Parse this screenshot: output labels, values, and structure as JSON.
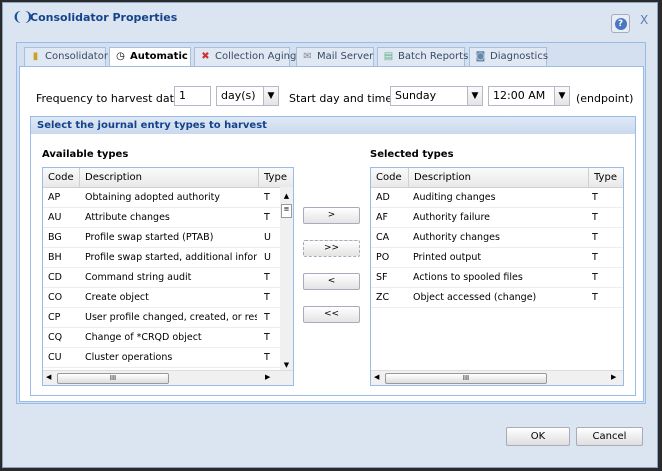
{
  "window": {
    "title": "Consolidator Properties",
    "help": "?",
    "close": "X"
  },
  "tabs": [
    {
      "label": "Consolidator",
      "icon": "consolidator-icon"
    },
    {
      "label": "Automatic",
      "icon": "clock-icon"
    },
    {
      "label": "Collection Aging",
      "icon": "aging-icon"
    },
    {
      "label": "Mail Server",
      "icon": "mail-icon"
    },
    {
      "label": "Batch Reports",
      "icon": "report-icon"
    },
    {
      "label": "Diagnostics",
      "icon": "diagnostics-icon"
    }
  ],
  "form": {
    "freq_label": "Frequency to harvest data:",
    "freq_value": "1",
    "unit": "day(s)",
    "start_label": "Start day and time:",
    "day": "Sunday",
    "time": "12:00 AM",
    "endpoint": "(endpoint)"
  },
  "section": {
    "title": "Select the journal entry types to harvest"
  },
  "available": {
    "title": "Available types",
    "columns": [
      "Code",
      "Description",
      "Type"
    ],
    "rows": [
      [
        "AP",
        "Obtaining adopted authority",
        "T"
      ],
      [
        "AU",
        "Attribute changes",
        "T"
      ],
      [
        "BG",
        "Profile swap started (PTAB)",
        "U"
      ],
      [
        "BH",
        "Profile swap started, additional informa...",
        "U"
      ],
      [
        "CD",
        "Command string audit",
        "T"
      ],
      [
        "CO",
        "Create object",
        "T"
      ],
      [
        "CP",
        "User profile changed, created, or resto...",
        "T"
      ],
      [
        "CQ",
        "Change of *CRQD object",
        "T"
      ],
      [
        "CU",
        "Cluster operations",
        "T"
      ]
    ]
  },
  "selected": {
    "title": "Selected types",
    "columns": [
      "Code",
      "Description",
      "Type"
    ],
    "rows": [
      [
        "AD",
        "Auditing changes",
        "T"
      ],
      [
        "AF",
        "Authority failure",
        "T"
      ],
      [
        "CA",
        "Authority changes",
        "T"
      ],
      [
        "PO",
        "Printed output",
        "T"
      ],
      [
        "SF",
        "Actions to spooled files",
        "T"
      ],
      [
        "ZC",
        "Object accessed (change)",
        "T"
      ]
    ]
  },
  "move_buttons": [
    ">",
    ">>",
    "<",
    "<<"
  ],
  "scroll_thumb": "III",
  "footer": {
    "ok": "OK",
    "cancel": "Cancel"
  }
}
